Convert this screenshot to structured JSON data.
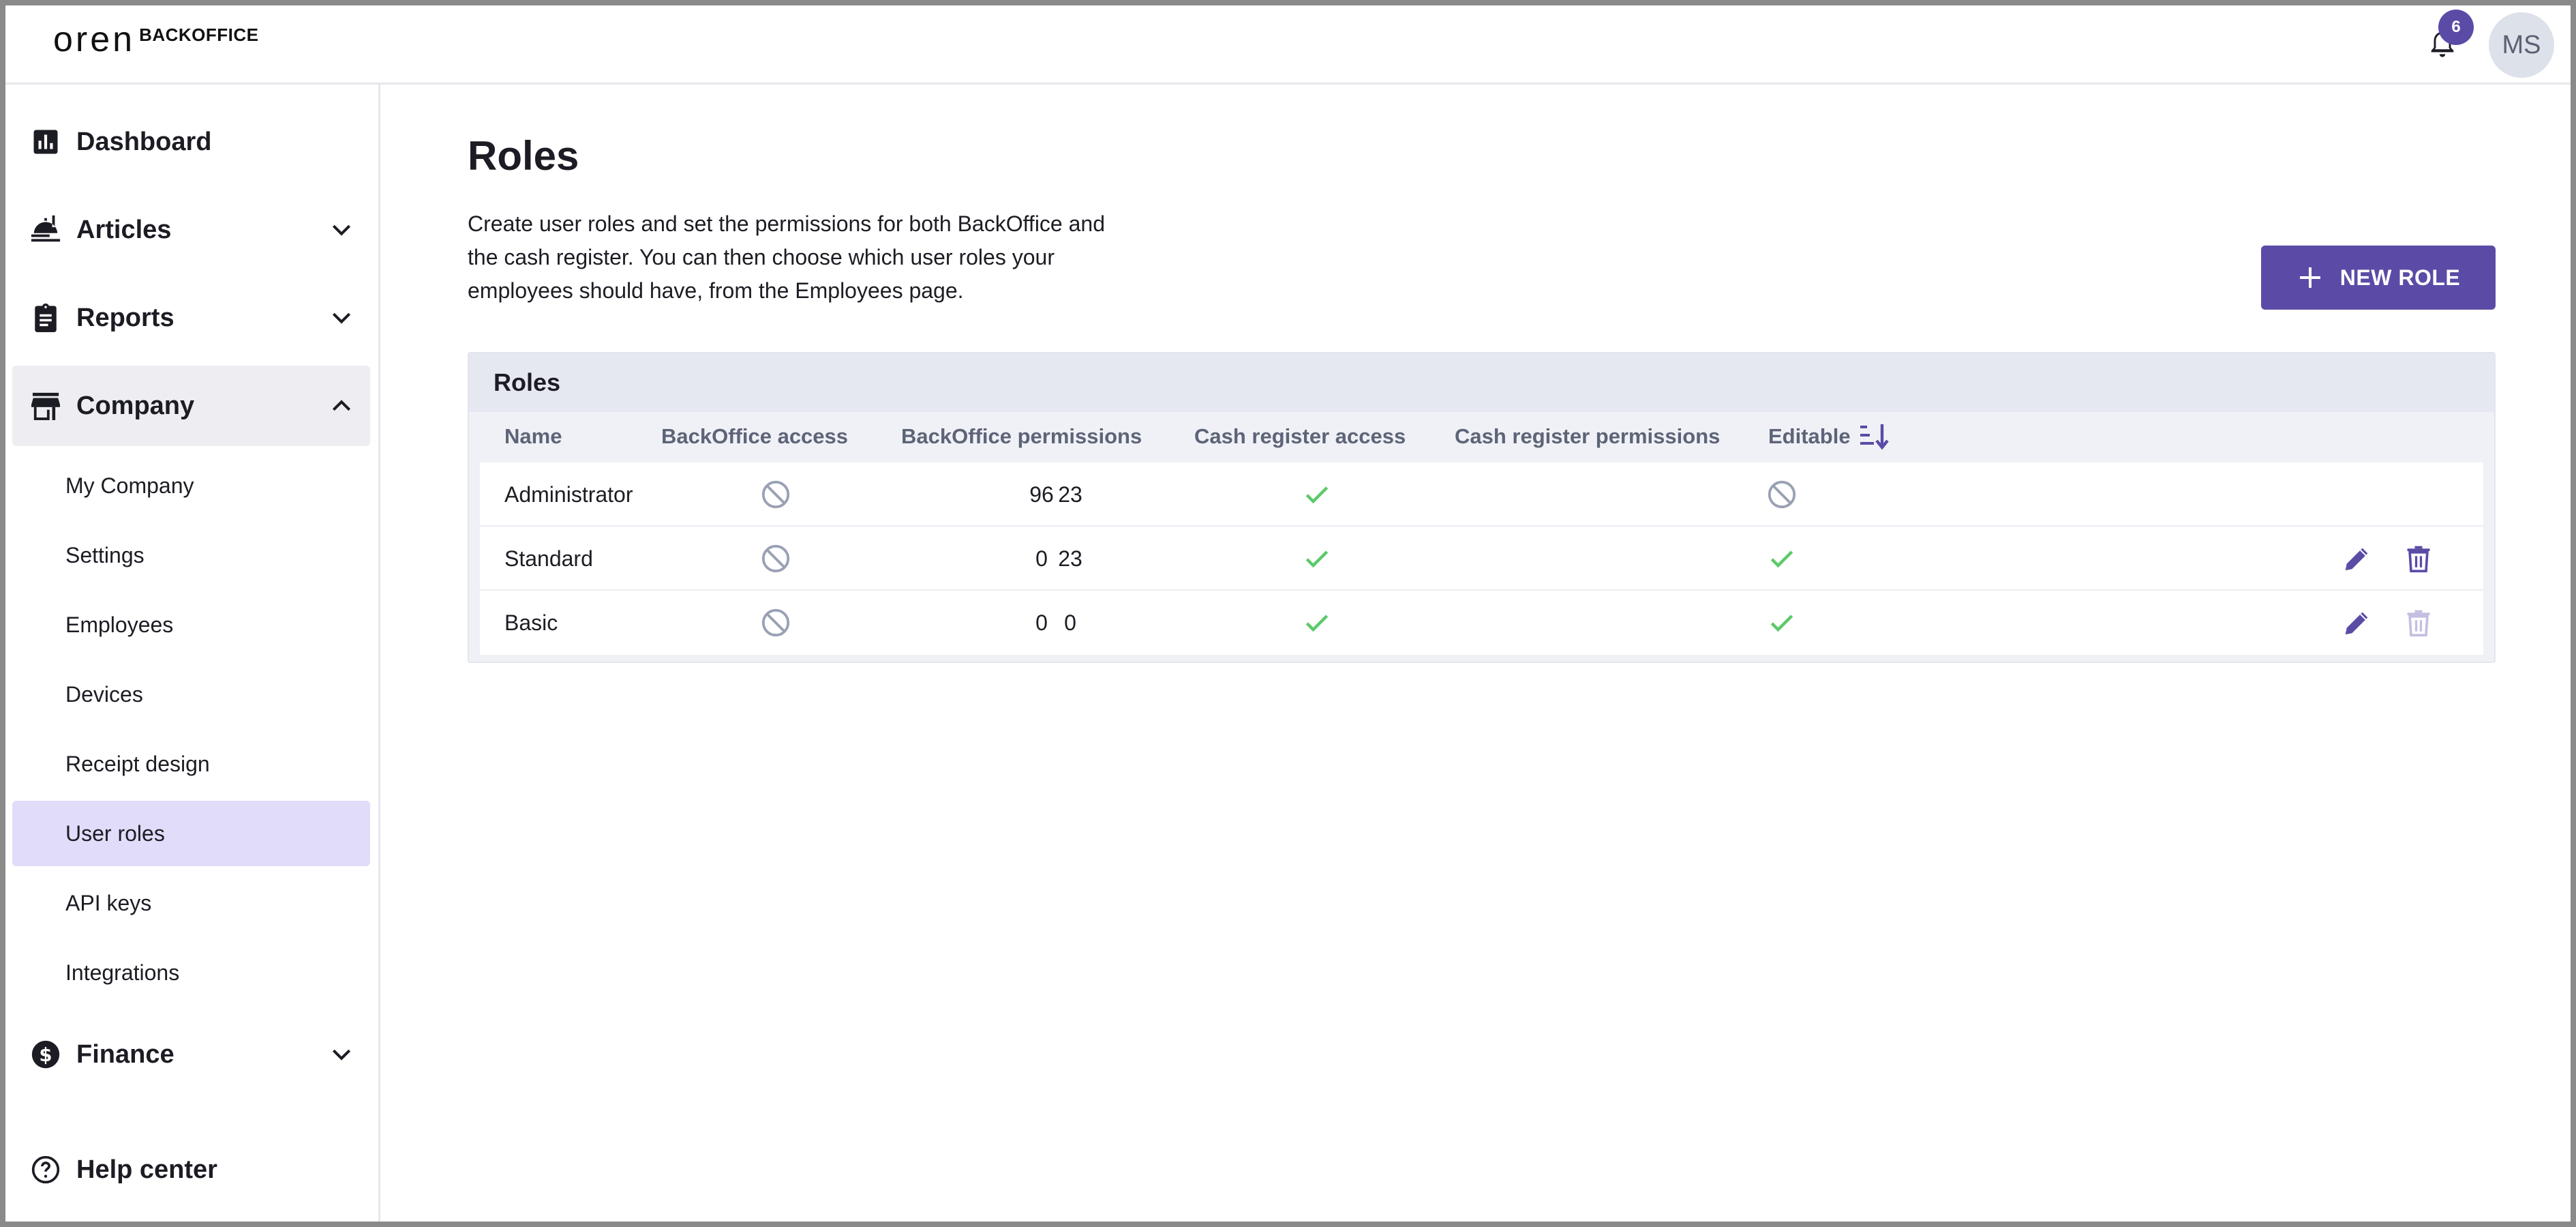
{
  "app": {
    "logo_mark": "oren",
    "logo_text": "BACKOFFICE",
    "notification_count": "6",
    "user_initials": "MS"
  },
  "sidebar": {
    "items": [
      {
        "label": "Dashboard",
        "icon": "bar-chart-icon"
      },
      {
        "label": "Articles",
        "icon": "food-tray-icon"
      },
      {
        "label": "Reports",
        "icon": "clipboard-icon"
      },
      {
        "label": "Company",
        "icon": "storefront-icon"
      }
    ],
    "company_children": [
      {
        "label": "My Company"
      },
      {
        "label": "Settings"
      },
      {
        "label": "Employees"
      },
      {
        "label": "Devices"
      },
      {
        "label": "Receipt design"
      },
      {
        "label": "User roles"
      },
      {
        "label": "API keys"
      },
      {
        "label": "Integrations"
      }
    ],
    "finance": {
      "label": "Finance",
      "icon": "dollar-circle-icon"
    },
    "help": {
      "label": "Help center",
      "icon": "help-circle-icon"
    }
  },
  "page": {
    "title": "Roles",
    "description": "Create user roles and set the permissions for both BackOffice and the cash register. You can then choose which user roles your employees should have, from the Employees page.",
    "new_role_label": "NEW ROLE"
  },
  "table": {
    "title": "Roles",
    "columns": [
      "Name",
      "BackOffice access",
      "BackOffice permissions",
      "Cash register access",
      "Cash register permissions",
      "Editable"
    ],
    "rows": [
      {
        "name": "Administrator",
        "backoffice_access": false,
        "backoffice_permissions": "96",
        "cash_register_access": true,
        "cash_register_permissions": "23",
        "editable": false,
        "can_delete": false
      },
      {
        "name": "Standard",
        "backoffice_access": false,
        "backoffice_permissions": "0",
        "cash_register_access": true,
        "cash_register_permissions": "23",
        "editable": true,
        "can_delete": true
      },
      {
        "name": "Basic",
        "backoffice_access": false,
        "backoffice_permissions": "0",
        "cash_register_access": true,
        "cash_register_permissions": "0",
        "editable": true,
        "can_delete": false
      }
    ]
  },
  "colors": {
    "accent": "#5b4ba6",
    "check": "#5cc96b",
    "blocked": "#9aa1b3",
    "active_item_bg": "#e1dcfa"
  }
}
